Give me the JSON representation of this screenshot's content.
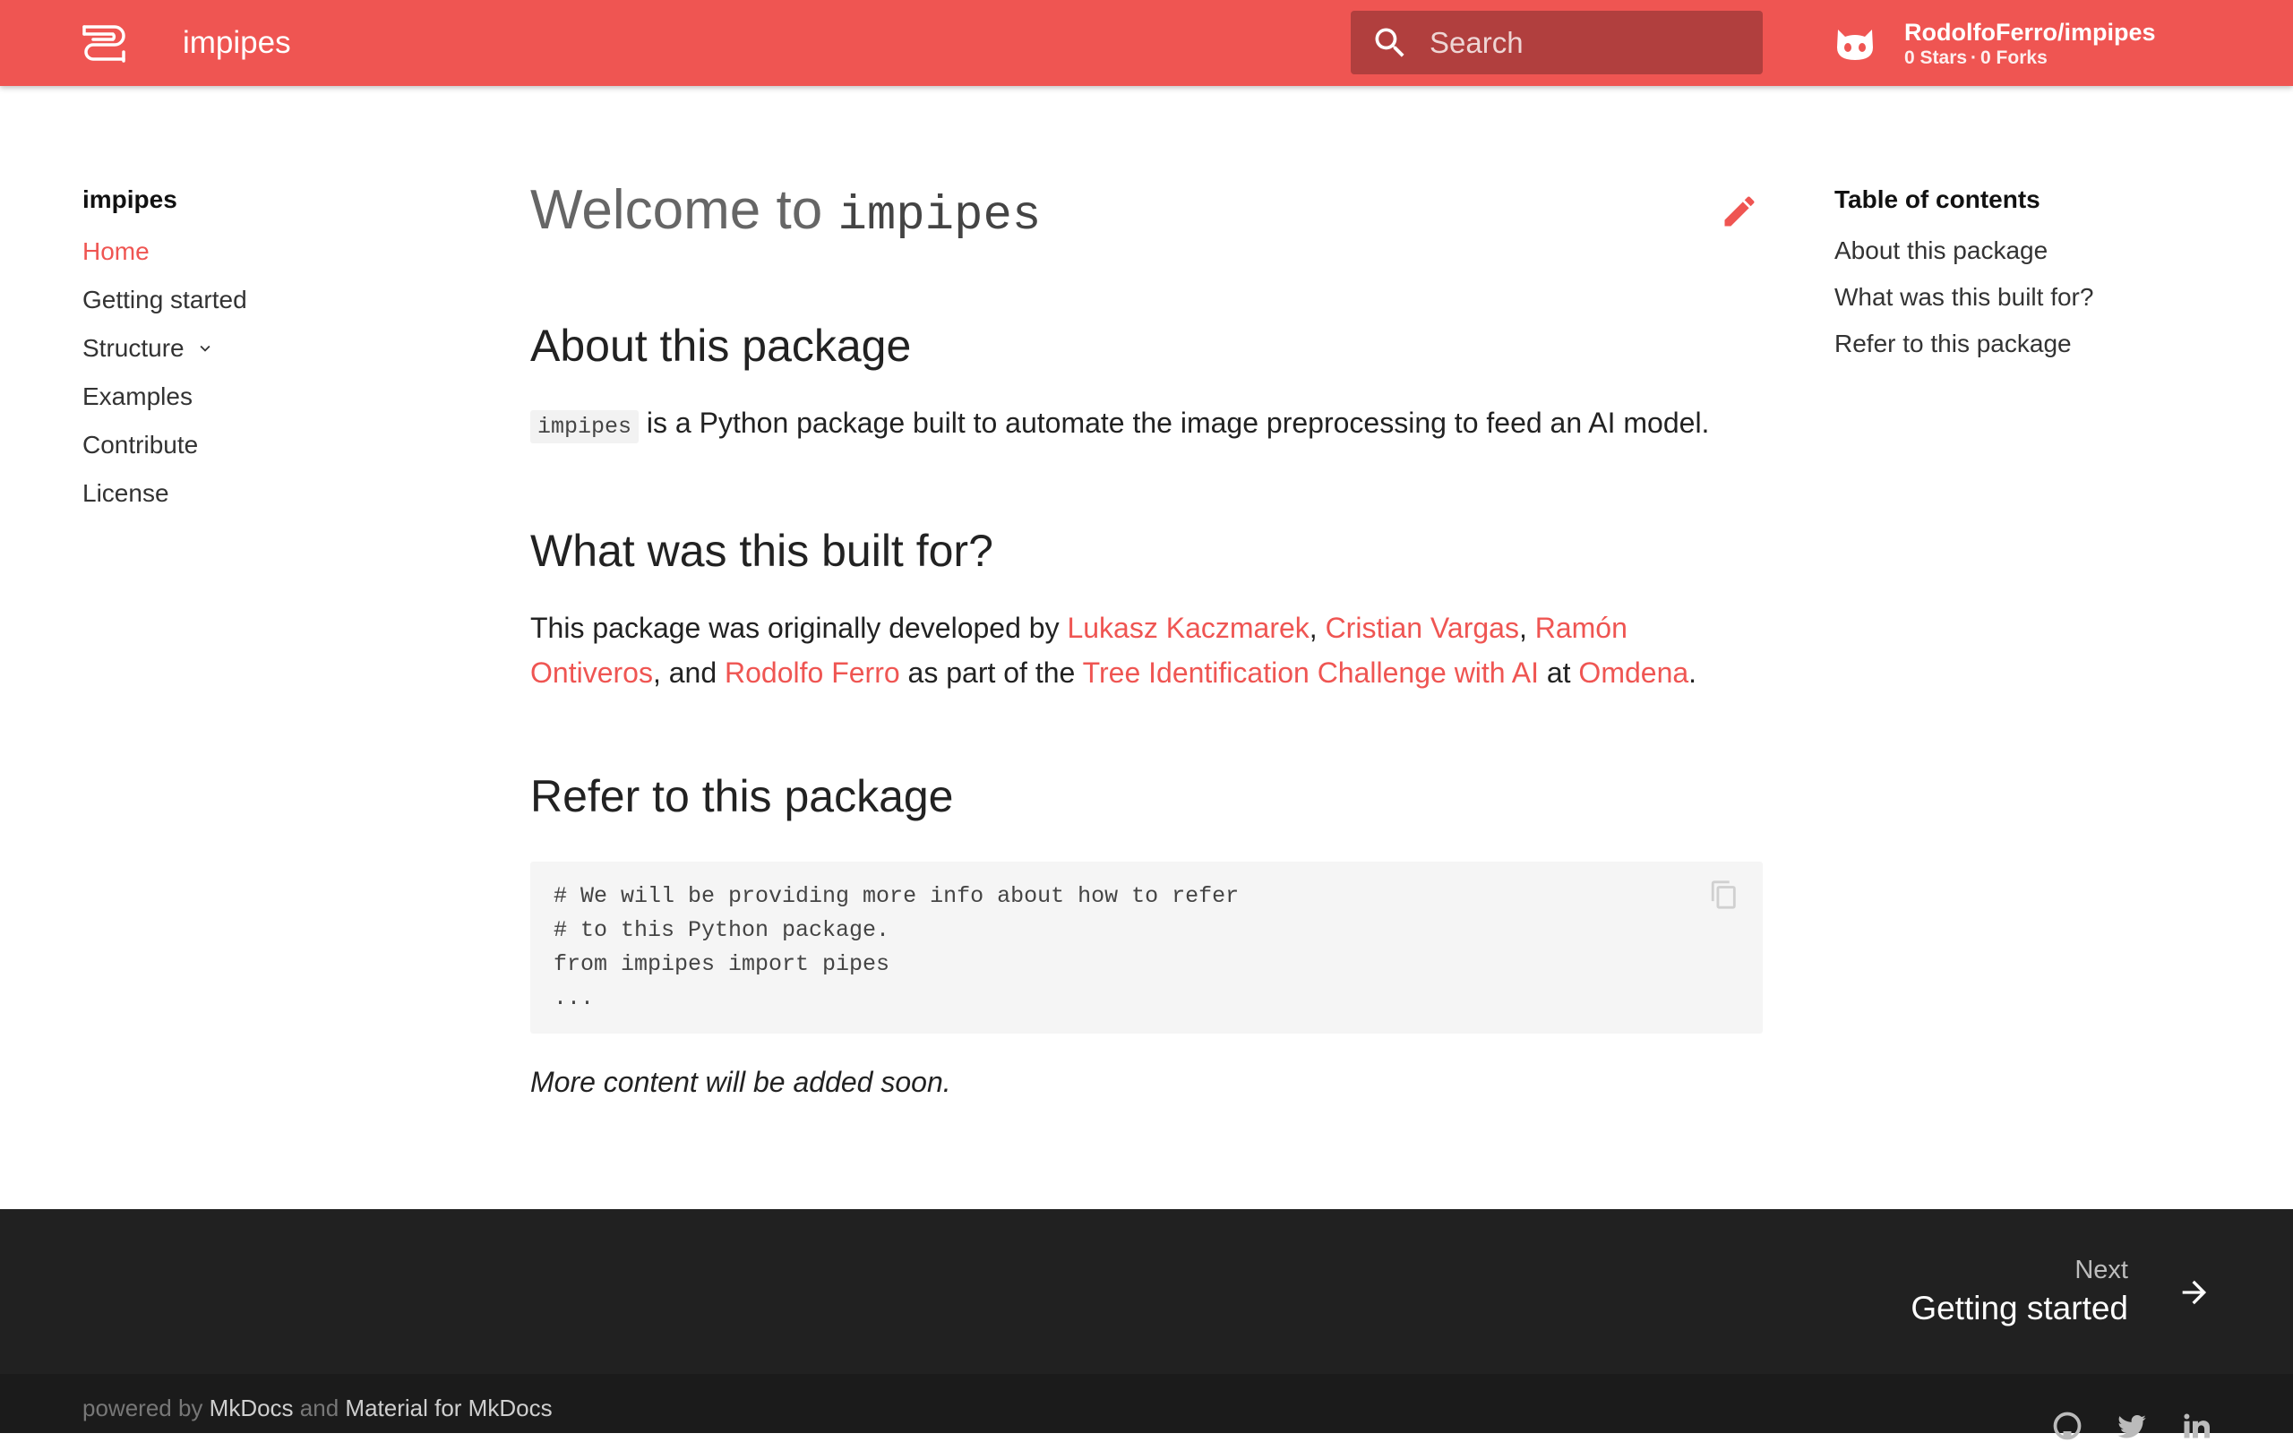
{
  "header": {
    "title": "impipes",
    "search_placeholder": "Search",
    "repo_name": "RodolfoFerro/impipes",
    "repo_stars": "0 Stars",
    "repo_forks": "0 Forks",
    "brand_color": "#ef5552"
  },
  "nav": {
    "title": "impipes",
    "items": [
      {
        "label": "Home",
        "active": true
      },
      {
        "label": "Getting started"
      },
      {
        "label": "Structure",
        "expandable": true
      },
      {
        "label": "Examples"
      },
      {
        "label": "Contribute"
      },
      {
        "label": "License"
      }
    ]
  },
  "toc": {
    "title": "Table of contents",
    "items": [
      "About this package",
      "What was this built for?",
      "Refer to this package"
    ]
  },
  "main": {
    "title_prefix": "Welcome to",
    "title_code": "impipes",
    "about": {
      "heading": "About this package",
      "code": "impipes",
      "text": "is a Python package built to automate the image preprocessing to feed an AI model."
    },
    "what": {
      "heading": "What was this built for?",
      "intro": "This package was originally developed by",
      "author1": "Lukasz Kaczmarek",
      "sep1": ",",
      "author2": "Cristian Vargas",
      "sep2": ",",
      "author3": "Ramón Ontiveros",
      "and_text": ", and",
      "author4": "Rodolfo Ferro",
      "part_text": "as part of the",
      "challenge": "Tree Identification Challenge with AI",
      "at_text": "at",
      "org": "Omdena",
      "end": "."
    },
    "refer": {
      "heading": "Refer to this package",
      "code": "# We will be providing more info about how to refer\n# to this Python package.\nfrom impipes import pipes\n..."
    },
    "note": "More content will be added soon."
  },
  "footer": {
    "next_label": "Next",
    "next_title": "Getting started",
    "powered_by": "powered by",
    "mkdocs": "MkDocs",
    "and": "and",
    "material": "Material for MkDocs"
  },
  "icons": [
    "logo-icon",
    "search-icon",
    "github-cat-icon",
    "chevron-down-icon",
    "edit-pencil-icon",
    "copy-icon",
    "arrow-right-icon",
    "github-icon",
    "twitter-icon",
    "linkedin-icon"
  ]
}
